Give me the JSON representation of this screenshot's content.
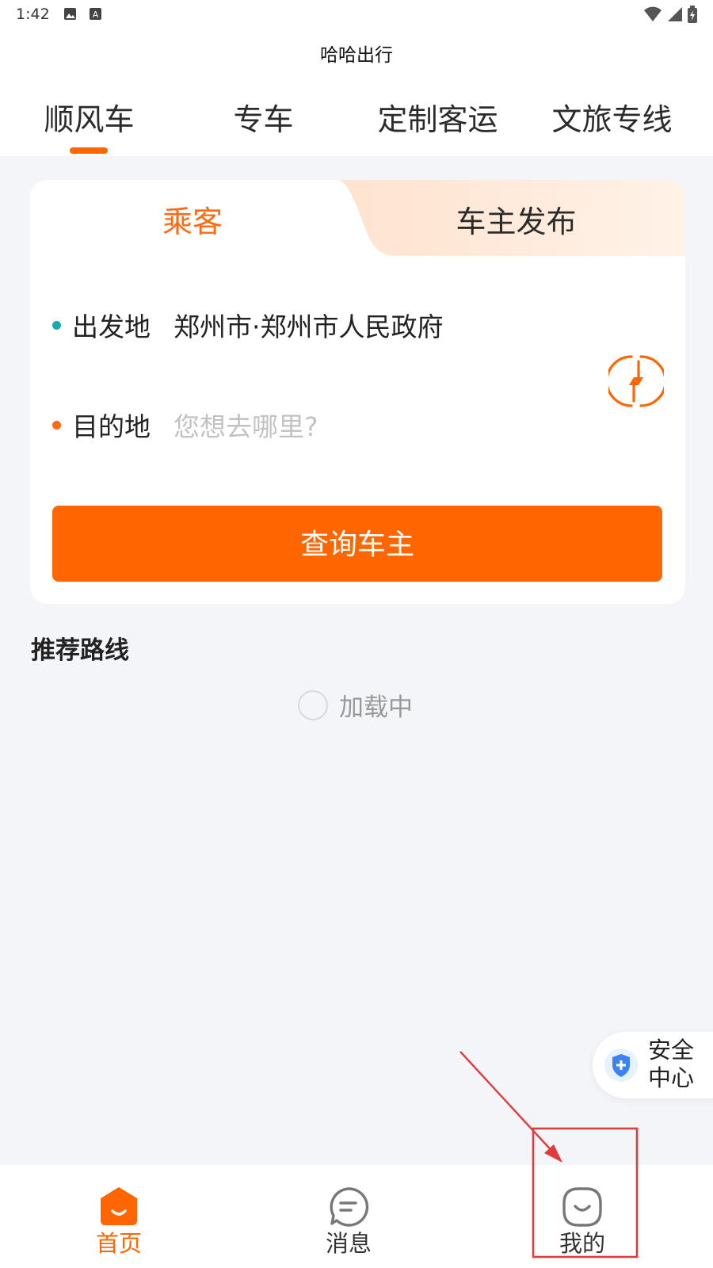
{
  "status_bar": {
    "time": "1:42"
  },
  "app": {
    "title": "哈哈出行"
  },
  "top_tabs": [
    {
      "label": "顺风车",
      "active": true
    },
    {
      "label": "专车",
      "active": false
    },
    {
      "label": "定制客运",
      "active": false
    },
    {
      "label": "文旅专线",
      "active": false
    }
  ],
  "role_tabs": {
    "passenger": "乘客",
    "driver": "车主发布",
    "active": "乘客"
  },
  "origin": {
    "label": "出发地",
    "value": "郑州市·郑州市人民政府"
  },
  "destination": {
    "label": "目的地",
    "placeholder": "您想去哪里?"
  },
  "query_button": "查询车主",
  "recommended": {
    "title": "推荐路线",
    "loading_text": "加载中"
  },
  "safety_center": {
    "line1": "安全",
    "line2": "中心"
  },
  "bottom_nav": [
    {
      "label": "首页",
      "icon": "home-smile-icon",
      "active": true
    },
    {
      "label": "消息",
      "icon": "message-icon",
      "active": false
    },
    {
      "label": "我的",
      "icon": "profile-smile-icon",
      "active": false
    }
  ],
  "colors": {
    "accent": "#ff6600",
    "origin_dot": "#1aa8b0",
    "destination_dot": "#ff6a13",
    "annotation": "#e03c3c"
  }
}
